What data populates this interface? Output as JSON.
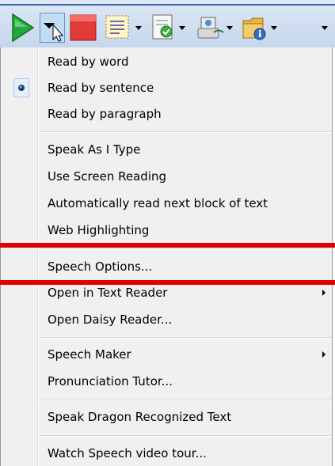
{
  "menu": {
    "items": [
      {
        "label": "Read by word"
      },
      {
        "label": "Read by sentence"
      },
      {
        "label": "Read by paragraph"
      },
      {
        "label": "Speak As I Type"
      },
      {
        "label": "Use Screen Reading"
      },
      {
        "label": "Automatically read next block of text"
      },
      {
        "label": "Web Highlighting"
      },
      {
        "label": "Speech Options..."
      },
      {
        "label": "Open in Text Reader"
      },
      {
        "label": "Open Daisy Reader..."
      },
      {
        "label": "Speech Maker"
      },
      {
        "label": "Pronunciation Tutor..."
      },
      {
        "label": "Speak Dragon Recognized Text"
      },
      {
        "label": "Watch Speech video tour..."
      }
    ],
    "selected_item": "Read by sentence"
  },
  "toolbar": {
    "icons": [
      "play-icon",
      "dropdown-arrow-icon",
      "stop-icon",
      "highlight-text-icon",
      "document-check-icon",
      "speaker-audio-icon",
      "folder-info-icon"
    ]
  },
  "colors": {
    "annotation_red": "#e10000",
    "play_green": "#22a83a",
    "stop_red": "#e23a35"
  }
}
